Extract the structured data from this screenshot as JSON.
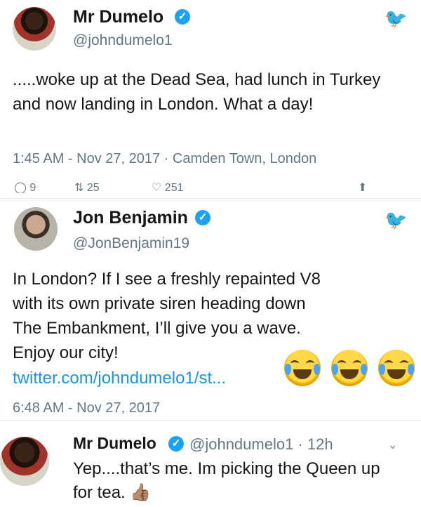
{
  "tweet1": {
    "name": "Mr Dumelo",
    "handle": "@johndumelo1",
    "text": ".....woke up at the Dead Sea, had lunch in Turkey and now landing in London. What a day!",
    "timestamp": "1:45 AM - Nov 27, 2017 · Camden Town, London",
    "actions": {
      "replies": "9",
      "retweets": "25",
      "likes": "251"
    }
  },
  "tweet2": {
    "name": "Jon Benjamin",
    "handle": "@JonBenjamin19",
    "text_line1": "In London? If I see a freshly repainted V8",
    "text_line2": "with its own private siren heading down",
    "text_line3": "The Embankment, I’ll give you a wave.",
    "text_line4": "Enjoy our city!",
    "link": "twitter.com/johndumelo1/st...",
    "timestamp": "6:48 AM - Nov 27, 2017"
  },
  "reply": {
    "name": "Mr Dumelo",
    "handle_time": "@johndumelo1 · 12h",
    "text_line1": "Yep....that’s me. Im picking the Queen up",
    "text_line2": "for tea.",
    "emoji_suffix": "👍🏽"
  },
  "icons": {
    "brand_color": "#1da1f2",
    "bird": "twitter-bird-icon",
    "verified": "verified-badge-icon",
    "emoji": "face-with-tears-of-joy-emoji"
  }
}
